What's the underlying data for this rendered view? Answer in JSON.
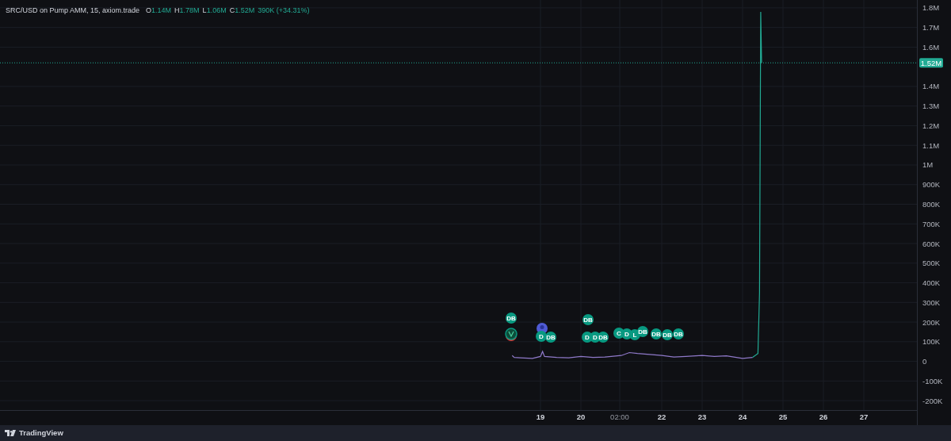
{
  "legend": {
    "title": "SRC/USD on Pump AMM, 15, axiom.trade",
    "ohlc": [
      {
        "label": "O",
        "value": "1.14M"
      },
      {
        "label": "H",
        "value": "1.78M"
      },
      {
        "label": "L",
        "value": "1.06M"
      },
      {
        "label": "C",
        "value": "1.52M"
      }
    ],
    "change": "390K (+34.31%)"
  },
  "chart": {
    "chart_data": {
      "type": "line",
      "grid": true,
      "x": [
        18.3,
        18.35,
        18.5,
        18.8,
        19.0,
        19.05,
        19.1,
        19.4,
        19.7,
        20.0,
        20.3,
        20.6,
        21.0,
        21.2,
        21.4,
        21.7,
        22.0,
        22.3,
        22.6,
        23.0,
        23.3,
        23.6,
        24.0,
        24.25,
        24.38,
        24.42,
        24.45,
        24.47
      ],
      "series": [
        {
          "color": "#8f79c9",
          "values": [
            30000,
            20000,
            18000,
            15000,
            25000,
            50000,
            25000,
            20000,
            18000,
            25000,
            20000,
            22000,
            30000,
            45000,
            40000,
            35000,
            30000,
            22000,
            25000,
            30000,
            25000,
            28000,
            15000,
            20000,
            null,
            null,
            null,
            null
          ]
        },
        {
          "color": "#22ab94",
          "values": [
            null,
            null,
            null,
            null,
            null,
            null,
            null,
            null,
            null,
            null,
            null,
            null,
            null,
            null,
            null,
            null,
            null,
            null,
            null,
            null,
            null,
            null,
            null,
            20000,
            40000,
            350000,
            1780000,
            1520000
          ]
        }
      ],
      "xlim": [
        5.627,
        28.314
      ],
      "ylim": [
        -248000,
        1840000
      ],
      "xticks": [
        {
          "value": 19,
          "label": "19"
        },
        {
          "value": 20,
          "label": "20"
        },
        {
          "value": 22,
          "label": "22"
        },
        {
          "value": 23,
          "label": "23"
        },
        {
          "value": 24,
          "label": "24"
        },
        {
          "value": 25,
          "label": "25"
        },
        {
          "value": 26,
          "label": "26"
        },
        {
          "value": 27,
          "label": "27"
        }
      ],
      "yticks": [
        {
          "value": 1800000,
          "label": "1.8M"
        },
        {
          "value": 1700000,
          "label": "1.7M"
        },
        {
          "value": 1600000,
          "label": "1.6M"
        },
        {
          "value": 1400000,
          "label": "1.4M"
        },
        {
          "value": 1300000,
          "label": "1.3M"
        },
        {
          "value": 1200000,
          "label": "1.2M"
        },
        {
          "value": 1100000,
          "label": "1.1M"
        },
        {
          "value": 1000000,
          "label": "1M"
        },
        {
          "value": 900000,
          "label": "900K"
        },
        {
          "value": 800000,
          "label": "800K"
        },
        {
          "value": 700000,
          "label": "700K"
        },
        {
          "value": 600000,
          "label": "600K"
        },
        {
          "value": 500000,
          "label": "500K"
        },
        {
          "value": 400000,
          "label": "400K"
        },
        {
          "value": 300000,
          "label": "300K"
        },
        {
          "value": 200000,
          "label": "200K"
        },
        {
          "value": 100000,
          "label": "100K"
        },
        {
          "value": 0,
          "label": "0"
        },
        {
          "value": -100000,
          "label": "-100K"
        },
        {
          "value": -200000,
          "label": "-200K"
        }
      ],
      "ref_lines": [
        {
          "axis": "y",
          "value": 1520000,
          "label": "1.52M",
          "color": "#22ab94"
        }
      ]
    },
    "session_label": "02:00",
    "markers": [
      {
        "kind": "badge",
        "text": "DB"
      },
      {
        "kind": "logo"
      },
      {
        "kind": "avatar"
      },
      {
        "kind": "badge",
        "text": "D"
      },
      {
        "kind": "badge",
        "text": "DB"
      },
      {
        "kind": "badge",
        "text": "DB"
      },
      {
        "kind": "badge",
        "text": "D"
      },
      {
        "kind": "badge",
        "text": "D"
      },
      {
        "kind": "badge",
        "text": "DB"
      },
      {
        "kind": "badge",
        "text": "C"
      },
      {
        "kind": "badge",
        "text": "D"
      },
      {
        "kind": "badge",
        "text": "L"
      },
      {
        "kind": "badge",
        "text": "DB"
      },
      {
        "kind": "badge",
        "text": "DB"
      },
      {
        "kind": "badge",
        "text": "DB"
      },
      {
        "kind": "badge",
        "text": "DB"
      }
    ]
  },
  "footer": {
    "brand": "TradingView"
  }
}
